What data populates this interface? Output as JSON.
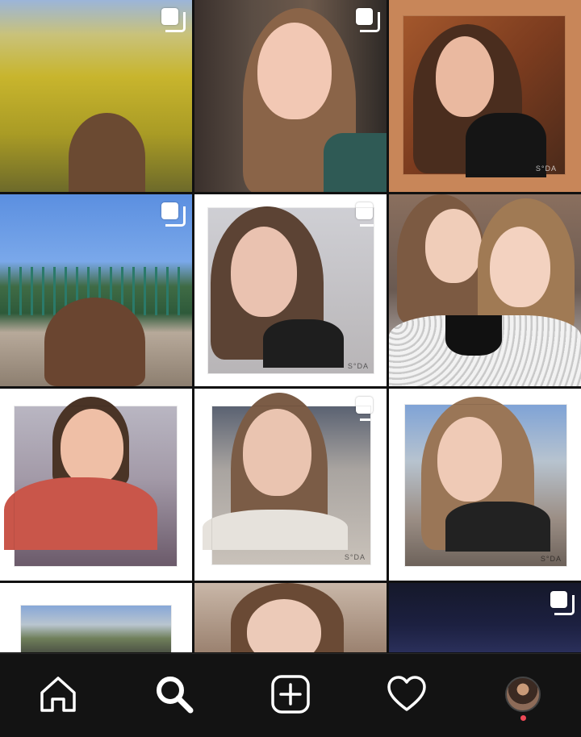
{
  "feed": {
    "tiles": [
      {
        "id": "t1",
        "multi": true,
        "watermark": ""
      },
      {
        "id": "t2",
        "multi": true,
        "watermark": ""
      },
      {
        "id": "t3",
        "multi": false,
        "watermark": "S°DA"
      },
      {
        "id": "t4",
        "multi": true,
        "watermark": ""
      },
      {
        "id": "t5",
        "multi": true,
        "watermark": "S°DA"
      },
      {
        "id": "t6",
        "multi": false,
        "watermark": ""
      },
      {
        "id": "t7",
        "multi": false,
        "watermark": ""
      },
      {
        "id": "t8",
        "multi": true,
        "watermark": "S°DA"
      },
      {
        "id": "t9",
        "multi": false,
        "watermark": "S°DA"
      },
      {
        "id": "t10",
        "multi": false,
        "watermark": ""
      },
      {
        "id": "t11",
        "multi": false,
        "watermark": ""
      },
      {
        "id": "t12",
        "multi": true,
        "watermark": ""
      }
    ]
  },
  "tabbar": {
    "tabs": [
      {
        "icon": "home-icon"
      },
      {
        "icon": "search-icon",
        "active": true
      },
      {
        "icon": "add-post-icon"
      },
      {
        "icon": "activity-heart-icon"
      },
      {
        "icon": "profile-avatar"
      }
    ],
    "notification_color": "#ed4956",
    "background": "#131313"
  }
}
